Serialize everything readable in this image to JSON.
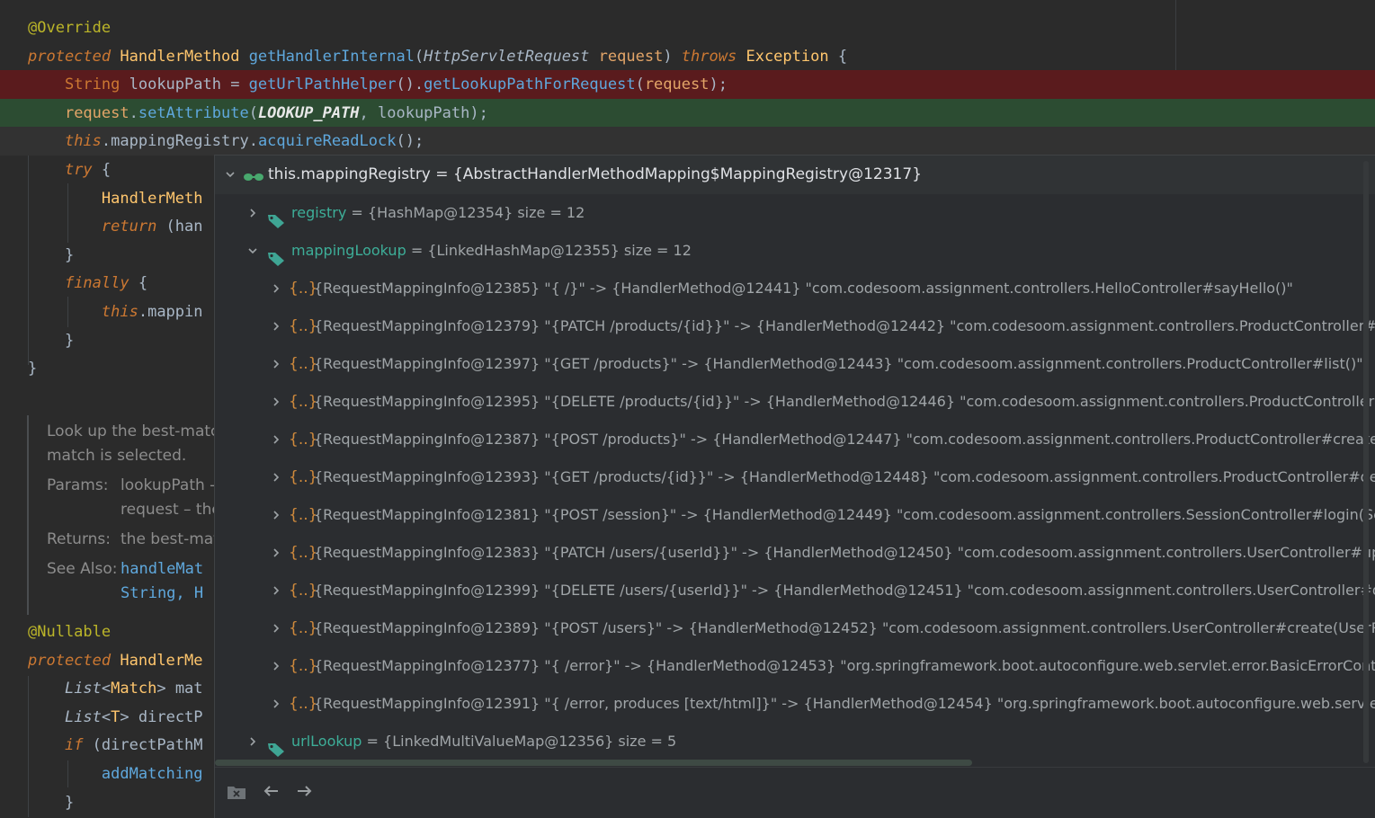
{
  "editor": {
    "lines": [
      {
        "segments": [
          [
            "ann",
            "@Override"
          ]
        ]
      },
      {
        "segments": [
          [
            "kw",
            "protected"
          ],
          [
            "plain",
            " "
          ],
          [
            "typ",
            "HandlerMethod"
          ],
          [
            "plain",
            " "
          ],
          [
            "fn",
            "getHandlerInternal"
          ],
          [
            "plain",
            "("
          ],
          [
            "ital",
            "HttpServletRequest"
          ],
          [
            "plain",
            " "
          ],
          [
            "param",
            "request"
          ],
          [
            "plain",
            ") "
          ],
          [
            "kw",
            "throws"
          ],
          [
            "plain",
            " "
          ],
          [
            "typ",
            "Exception"
          ],
          [
            "plain",
            " {"
          ]
        ]
      },
      {
        "segments": [
          [
            "plain",
            "    "
          ],
          [
            "kwn",
            "String"
          ],
          [
            "plain",
            " lookupPath = "
          ],
          [
            "fn",
            "getUrlPathHelper"
          ],
          [
            "plain",
            "()."
          ],
          [
            "fn",
            "getLookupPathForRequest"
          ],
          [
            "plain",
            "("
          ],
          [
            "param",
            "request"
          ],
          [
            "plain",
            ");"
          ]
        ]
      },
      {
        "segments": [
          [
            "plain",
            "    "
          ],
          [
            "param",
            "request"
          ],
          [
            "plain",
            "."
          ],
          [
            "fn",
            "setAttribute"
          ],
          [
            "plain",
            "("
          ],
          [
            "const",
            "LOOKUP_PATH"
          ],
          [
            "plain",
            ", lookupPath);"
          ]
        ]
      },
      {
        "segments": [
          [
            "plain",
            "    "
          ],
          [
            "kw",
            "this"
          ],
          [
            "plain",
            "."
          ],
          [
            "plain",
            "mappingRegistry"
          ],
          [
            "plain",
            "."
          ],
          [
            "fn",
            "acquireReadLock"
          ],
          [
            "plain",
            "();"
          ]
        ]
      },
      {
        "segments": [
          [
            "plain",
            "    "
          ],
          [
            "kw",
            "try"
          ],
          [
            "plain",
            " {"
          ]
        ]
      },
      {
        "segments": [
          [
            "plain",
            "        "
          ],
          [
            "typ",
            "HandlerMeth"
          ]
        ]
      },
      {
        "segments": [
          [
            "plain",
            "        "
          ],
          [
            "kw",
            "return"
          ],
          [
            "plain",
            " (han"
          ]
        ]
      },
      {
        "segments": [
          [
            "plain",
            "    }"
          ]
        ]
      },
      {
        "segments": [
          [
            "plain",
            "    "
          ],
          [
            "kw",
            "finally"
          ],
          [
            "plain",
            " {"
          ]
        ]
      },
      {
        "segments": [
          [
            "plain",
            "        "
          ],
          [
            "kw",
            "this"
          ],
          [
            "plain",
            ".mappin"
          ]
        ]
      },
      {
        "segments": [
          [
            "plain",
            "    }"
          ]
        ]
      },
      {
        "segments": [
          [
            "plain",
            "}"
          ]
        ]
      }
    ],
    "lines2": [
      {
        "segments": [
          [
            "ann",
            "@Nullable"
          ]
        ]
      },
      {
        "segments": [
          [
            "kw",
            "protected"
          ],
          [
            "plain",
            " "
          ],
          [
            "typ",
            "HandlerMe"
          ]
        ]
      },
      {
        "segments": [
          [
            "plain",
            "    "
          ],
          [
            "ital",
            "List"
          ],
          [
            "plain",
            "<"
          ],
          [
            "typ",
            "Match"
          ],
          [
            "plain",
            "> mat"
          ]
        ]
      },
      {
        "segments": [
          [
            "plain",
            "    "
          ],
          [
            "ital",
            "List"
          ],
          [
            "plain",
            "<"
          ],
          [
            "typ",
            "T"
          ],
          [
            "plain",
            "> directP"
          ]
        ]
      },
      {
        "segments": [
          [
            "plain",
            "    "
          ],
          [
            "kw",
            "if"
          ],
          [
            "plain",
            " (directPathM"
          ]
        ]
      },
      {
        "segments": [
          [
            "plain",
            "        "
          ],
          [
            "fn",
            "addMatching"
          ]
        ]
      },
      {
        "segments": [
          [
            "plain",
            "    }"
          ]
        ]
      }
    ],
    "doc": {
      "line1": "Look up the best-matc",
      "line2": "match is selected.",
      "params_label": "Params:",
      "params_line1": "lookupPath -",
      "params_line2": "request – the",
      "returns_label": "Returns:",
      "returns_text": "the best-mat",
      "see_also_label": "See Also:",
      "see_also_link1": "handleMat",
      "see_also_link2": "String, H"
    }
  },
  "popup": {
    "root": {
      "icon": "watch-glasses-icon",
      "text": "this.mappingRegistry = {AbstractHandlerMethodMapping$MappingRegistry@12317}"
    },
    "registry": {
      "name": "registry",
      "value": " = {HashMap@12354}  size = 12"
    },
    "mappingLookup": {
      "name": "mappingLookup",
      "value": " = {LinkedHashMap@12355}  size = 12"
    },
    "entries": [
      "{RequestMappingInfo@12385} \"{ /}\" -> {HandlerMethod@12441} \"com.codesoom.assignment.controllers.HelloController#sayHello()\"",
      "{RequestMappingInfo@12379} \"{PATCH /products/{id}}\" -> {HandlerMethod@12442} \"com.codesoom.assignment.controllers.ProductController#upc",
      "{RequestMappingInfo@12397} \"{GET /products}\" -> {HandlerMethod@12443} \"com.codesoom.assignment.controllers.ProductController#list()\"",
      "{RequestMappingInfo@12395} \"{DELETE /products/{id}}\" -> {HandlerMethod@12446} \"com.codesoom.assignment.controllers.ProductController#de",
      "{RequestMappingInfo@12387} \"{POST /products}\" -> {HandlerMethod@12447} \"com.codesoom.assignment.controllers.ProductController#create(Pr",
      "{RequestMappingInfo@12393} \"{GET /products/{id}}\" -> {HandlerMethod@12448} \"com.codesoom.assignment.controllers.ProductController#detail(",
      "{RequestMappingInfo@12381} \"{POST /session}\" -> {HandlerMethod@12449} \"com.codesoom.assignment.controllers.SessionController#login(Sessi",
      "{RequestMappingInfo@12383} \"{PATCH /users/{userId}}\" -> {HandlerMethod@12450} \"com.codesoom.assignment.controllers.UserController#updat",
      "{RequestMappingInfo@12399} \"{DELETE /users/{userId}}\" -> {HandlerMethod@12451} \"com.codesoom.assignment.controllers.UserController#destro",
      "{RequestMappingInfo@12389} \"{POST /users}\" -> {HandlerMethod@12452} \"com.codesoom.assignment.controllers.UserController#create(UserRegis",
      "{RequestMappingInfo@12377} \"{ /error}\" -> {HandlerMethod@12453} \"org.springframework.boot.autoconfigure.web.servlet.error.BasicErrorControll",
      "{RequestMappingInfo@12391} \"{ /error, produces [text/html]}\" -> {HandlerMethod@12454} \"org.springframework.boot.autoconfigure.web.servlet.er"
    ],
    "entry_icon": "{..}",
    "urlLookup": {
      "name": "urlLookup",
      "value": " = {LinkedMultiValueMap@12356}  size = 5"
    },
    "footer": {
      "remove_icon": "remove-watch-icon",
      "back_icon": "back-arrow-icon",
      "forward_icon": "forward-arrow-icon"
    }
  },
  "colors": {
    "background": "#2b2b2b",
    "error_line": "#5a1b1d",
    "exec_line": "#2c4c32",
    "field_name": "#3dae98",
    "object_icon": "#d08a3c"
  }
}
